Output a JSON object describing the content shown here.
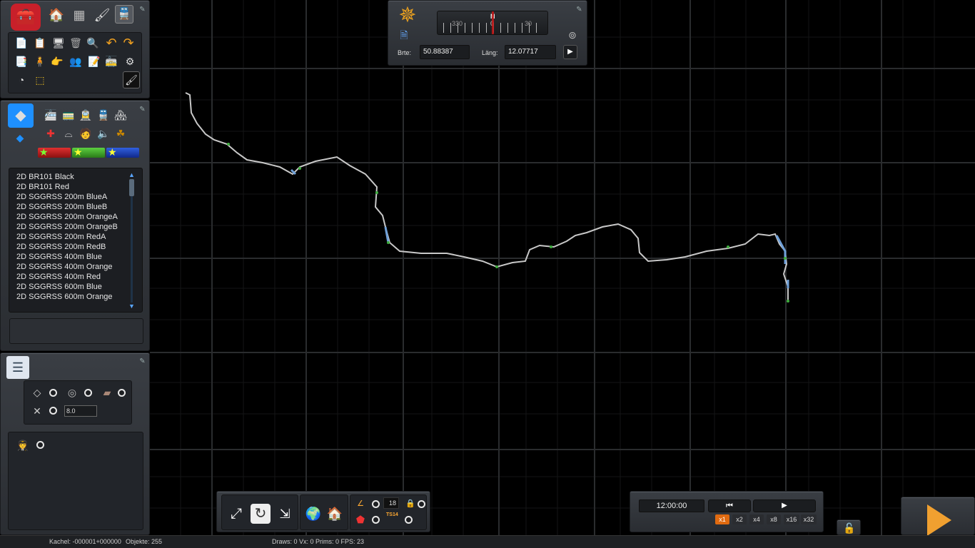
{
  "compass": {
    "heading_marks": [
      "330",
      "N",
      "0",
      "30"
    ],
    "lat_label": "Brte:",
    "lat_value": "50.88387",
    "lon_label": "Läng:",
    "lon_value": "12.07717"
  },
  "object_list": {
    "items": [
      "2D BR101 Black",
      "2D BR101 Red",
      "2D SGGRSS 200m BlueA",
      "2D SGGRSS 200m BlueB",
      "2D SGGRSS 200m OrangeA",
      "2D SGGRSS 200m OrangeB",
      "2D SGGRSS 200m RedA",
      "2D SGGRSS 200m RedB",
      "2D SGGRSS 400m Blue",
      "2D SGGRSS 400m Orange",
      "2D SGGRSS 400m Red",
      "2D SGGRSS 600m Blue",
      "2D SGGRSS 600m Orange"
    ]
  },
  "properties": {
    "spacing_value": "8.0"
  },
  "layers": {
    "tile_value": "18",
    "ts_label": "TS14"
  },
  "time": {
    "clock": "12:00:00",
    "speeds": [
      "x1",
      "x2",
      "x4",
      "x8",
      "x16",
      "x32"
    ],
    "active_speed": "x1"
  },
  "status": {
    "tile": "Kachel: -000001+000000",
    "objects": "Objekte: 255",
    "draws": "Draws: 0 Vx: 0 Prims: 0 FPS: 23"
  },
  "colors": {
    "route": "#c8c8c8",
    "grid_major": "#2b2d2f",
    "grid_minor": "#151617",
    "accent": "#e06a10",
    "water": "#6fa0d8",
    "vegetation": "#3fae3f"
  }
}
